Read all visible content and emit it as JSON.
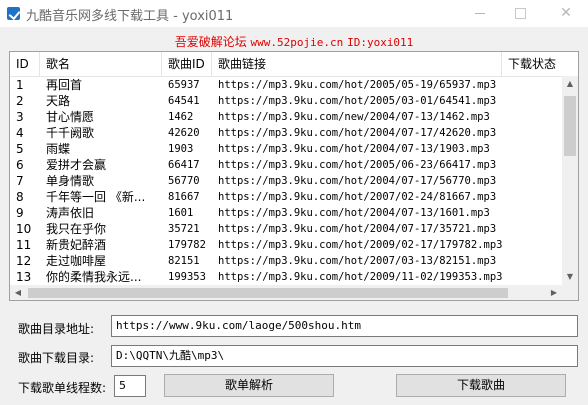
{
  "window": {
    "title": "九酷音乐网多线下载工具 - yoxi011"
  },
  "banner": {
    "text": "吾爱破解论坛",
    "url": "www.52pojie.cn",
    "id": "ID:yoxi011"
  },
  "table": {
    "columns": [
      "ID",
      "歌名",
      "歌曲ID",
      "歌曲链接",
      "下载状态"
    ],
    "rows": [
      [
        "1",
        "再回首",
        "65937",
        "https://mp3.9ku.com/hot/2005/05-19/65937.mp3",
        ""
      ],
      [
        "2",
        "天路",
        "64541",
        "https://mp3.9ku.com/hot/2005/03-01/64541.mp3",
        ""
      ],
      [
        "3",
        "甘心情愿",
        "1462",
        "https://mp3.9ku.com/new/2004/07-13/1462.mp3",
        ""
      ],
      [
        "4",
        "千千阙歌",
        "42620",
        "https://mp3.9ku.com/hot/2004/07-17/42620.mp3",
        ""
      ],
      [
        "5",
        "雨蝶",
        "1903",
        "https://mp3.9ku.com/hot/2004/07-13/1903.mp3",
        ""
      ],
      [
        "6",
        "爱拼才会赢",
        "66417",
        "https://mp3.9ku.com/hot/2005/06-23/66417.mp3",
        ""
      ],
      [
        "7",
        "单身情歌",
        "56770",
        "https://mp3.9ku.com/hot/2004/07-17/56770.mp3",
        ""
      ],
      [
        "8",
        "千年等一回 《新...",
        "81667",
        "https://mp3.9ku.com/hot/2007/02-24/81667.mp3",
        ""
      ],
      [
        "9",
        "涛声依旧",
        "1601",
        "https://mp3.9ku.com/hot/2004/07-13/1601.mp3",
        ""
      ],
      [
        "10",
        "我只在乎你",
        "35721",
        "https://mp3.9ku.com/hot/2004/07-17/35721.mp3",
        ""
      ],
      [
        "11",
        "新贵妃醉酒",
        "179782",
        "https://mp3.9ku.com/hot/2009/02-17/179782.mp3",
        ""
      ],
      [
        "12",
        "走过咖啡屋",
        "82151",
        "https://mp3.9ku.com/hot/2007/03-13/82151.mp3",
        ""
      ],
      [
        "13",
        "你的柔情我永远...",
        "199353",
        "https://mp3.9ku.com/hot/2009/11-02/199353.mp3",
        ""
      ]
    ]
  },
  "form": {
    "catalog_label": "歌曲目录地址:",
    "catalog_value": "https://www.9ku.com/laoge/500shou.htm",
    "download_dir_label": "歌曲下载目录:",
    "download_dir_value": "D:\\QQTN\\九酷\\mp3\\",
    "threads_label": "下载歌单线程数:",
    "threads_value": "5",
    "parse_button": "歌单解析",
    "download_button": "下载歌曲"
  },
  "icons": [
    "app-icon",
    "minimize-icon",
    "maximize-icon",
    "close-icon"
  ]
}
